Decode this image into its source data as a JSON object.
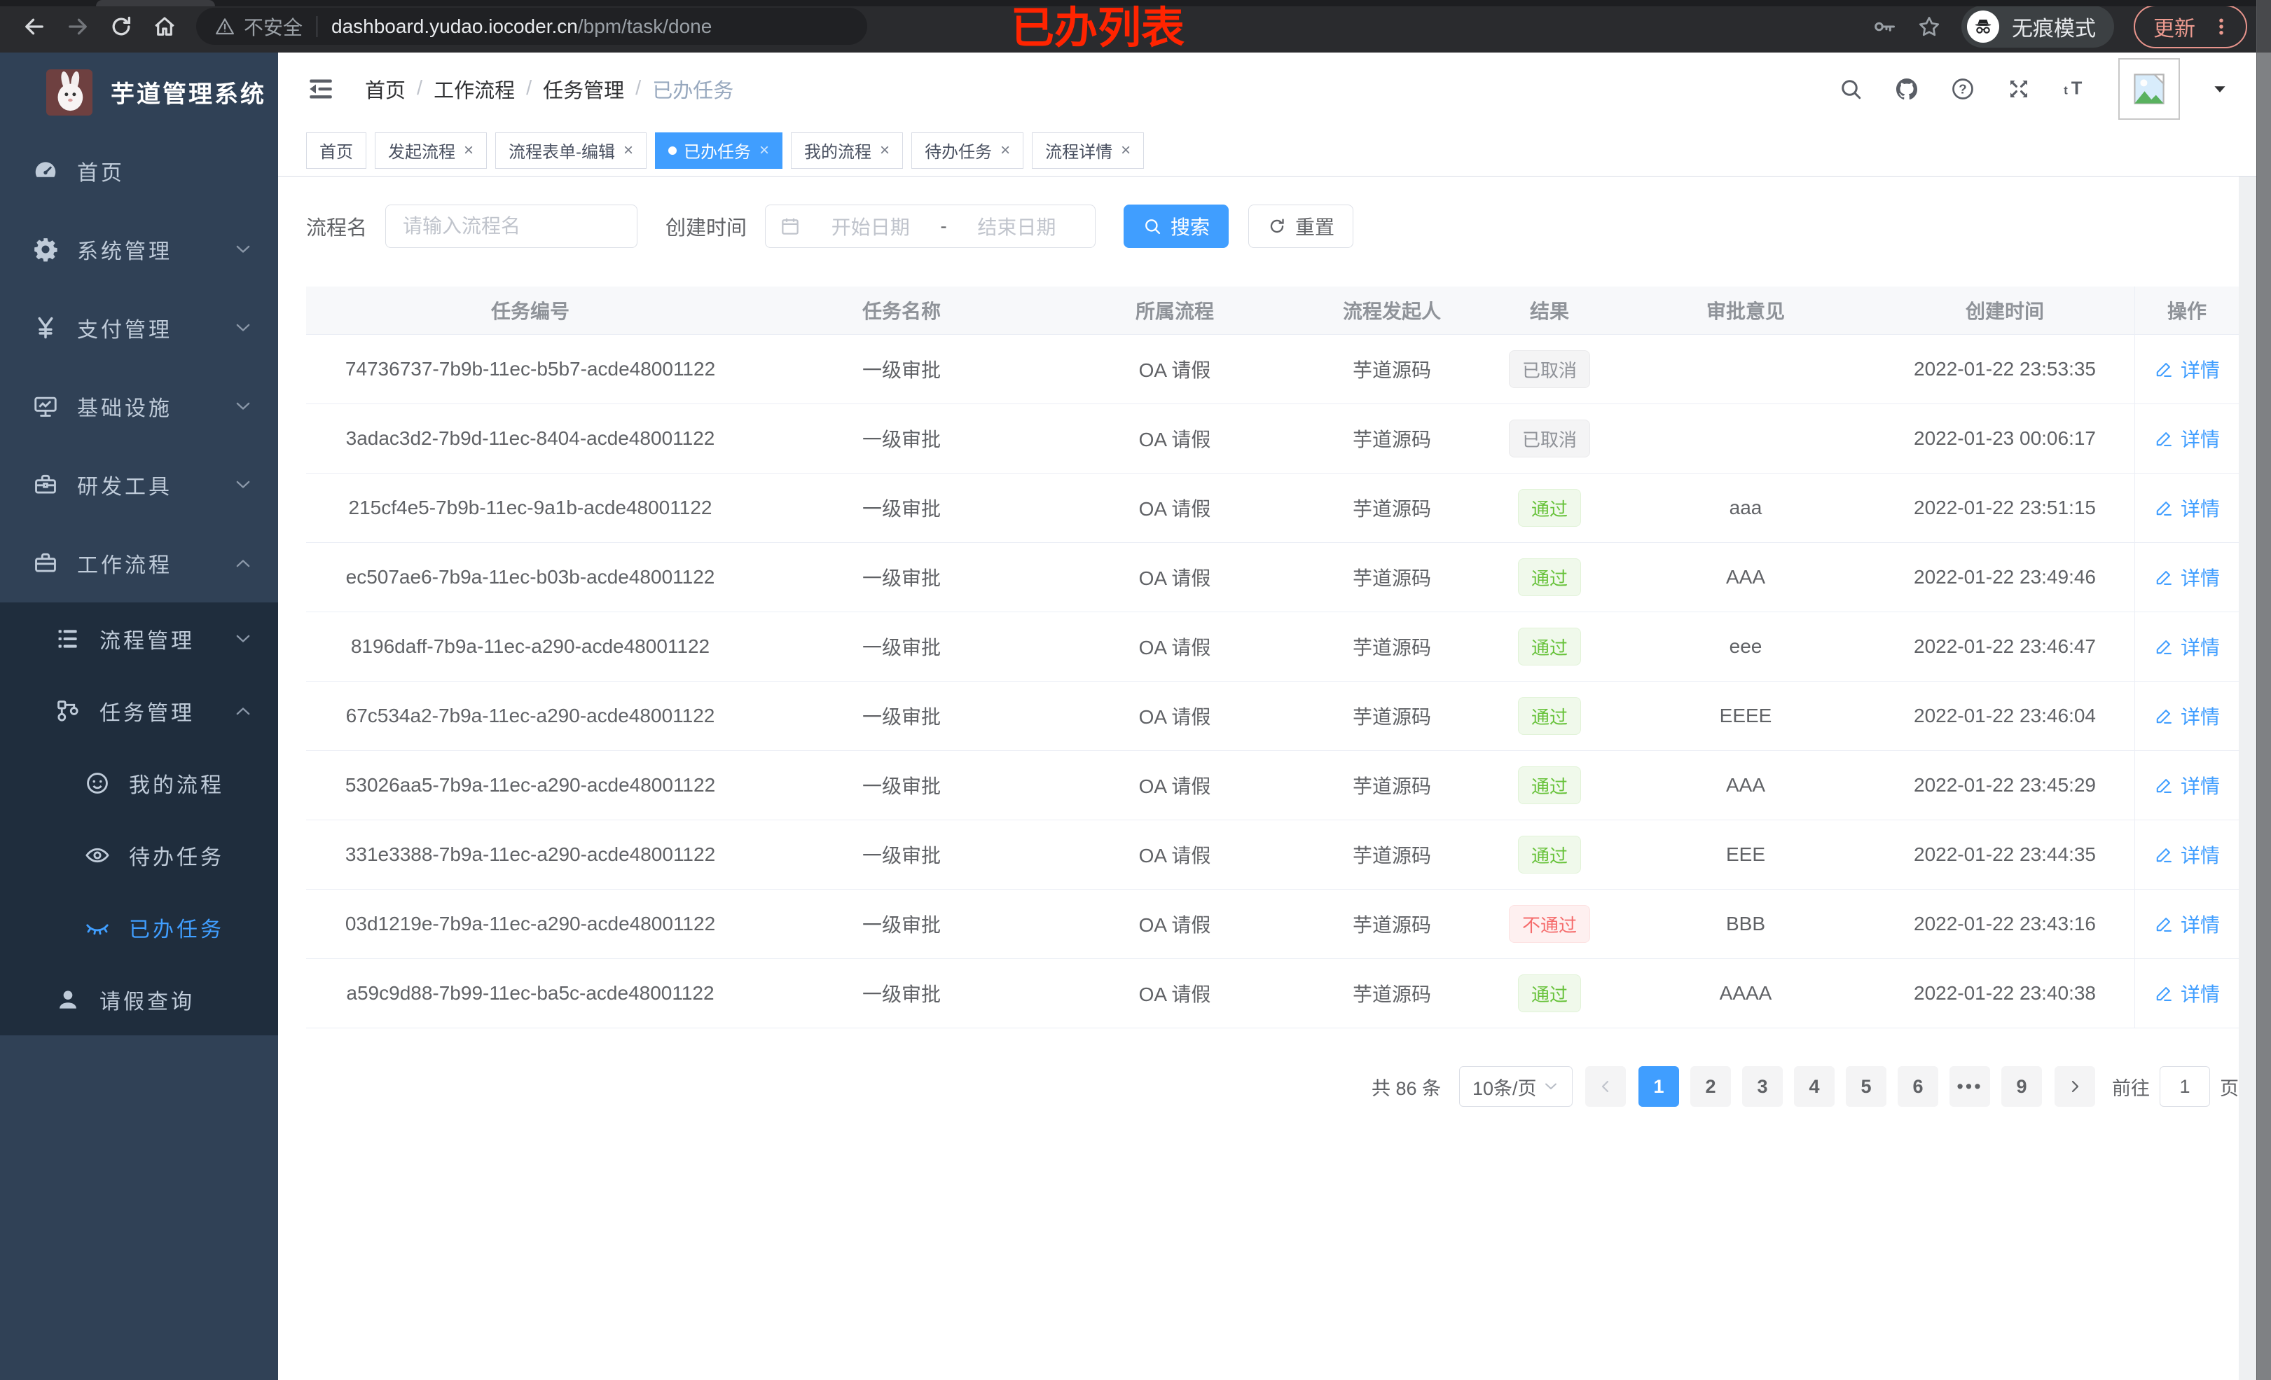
{
  "browser": {
    "annotation": "已办列表",
    "security_label": "不安全",
    "url_host": "dashboard.yudao.iocoder.cn",
    "url_path": "/bpm/task/done",
    "incognito_label": "无痕模式",
    "update_label": "更新"
  },
  "sidebar": {
    "app_title": "芋道管理系统",
    "items": [
      {
        "icon": "dashboard-icon",
        "label": "首页",
        "cls": "lvl1",
        "chev": ""
      },
      {
        "icon": "gear-icon",
        "label": "系统管理",
        "cls": "lvl1",
        "chev": "down"
      },
      {
        "icon": "yen-icon",
        "label": "支付管理",
        "cls": "lvl1",
        "chev": "down"
      },
      {
        "icon": "infra-icon",
        "label": "基础设施",
        "cls": "lvl1",
        "chev": "down"
      },
      {
        "icon": "tools-icon",
        "label": "研发工具",
        "cls": "lvl1",
        "chev": "down"
      },
      {
        "icon": "workflow-icon",
        "label": "工作流程",
        "cls": "lvl1",
        "chev": "up"
      }
    ],
    "workflow_children": [
      {
        "icon": "process-manage-icon",
        "label": "流程管理",
        "cls": "lvl2",
        "chev": "down"
      },
      {
        "icon": "task-manage-icon",
        "label": "任务管理",
        "cls": "lvl2",
        "chev": "up"
      },
      {
        "icon": "my-process-icon",
        "label": "我的流程",
        "cls": "lvl3",
        "chev": ""
      },
      {
        "icon": "todo-task-icon",
        "label": "待办任务",
        "cls": "lvl3",
        "chev": ""
      },
      {
        "icon": "done-task-icon",
        "label": "已办任务",
        "cls": "lvl3 active",
        "chev": ""
      },
      {
        "icon": "leave-query-icon",
        "label": "请假查询",
        "cls": "lvl2",
        "chev": ""
      }
    ]
  },
  "header": {
    "breadcrumb": [
      {
        "label": "首页",
        "cls": "",
        "sep": "/"
      },
      {
        "label": "工作流程",
        "cls": "",
        "sep": "/"
      },
      {
        "label": "任务管理",
        "cls": "",
        "sep": "/"
      },
      {
        "label": "已办任务",
        "cls": "muted",
        "sep": ""
      }
    ]
  },
  "tabs": [
    {
      "label": "首页",
      "cls": "",
      "active": false,
      "closable": false
    },
    {
      "label": "发起流程",
      "cls": "",
      "active": false,
      "closable": true
    },
    {
      "label": "流程表单-编辑",
      "cls": "",
      "active": false,
      "closable": true
    },
    {
      "label": "已办任务",
      "cls": "active",
      "active": true,
      "closable": true
    },
    {
      "label": "我的流程",
      "cls": "",
      "active": false,
      "closable": true
    },
    {
      "label": "待办任务",
      "cls": "",
      "active": false,
      "closable": true
    },
    {
      "label": "流程详情",
      "cls": "",
      "active": false,
      "closable": true
    }
  ],
  "filters": {
    "name_label": "流程名",
    "name_placeholder": "请输入流程名",
    "time_label": "创建时间",
    "start_placeholder": "开始日期",
    "range_separator": "-",
    "end_placeholder": "结束日期",
    "search_label": "搜索",
    "reset_label": "重置"
  },
  "table": {
    "columns": [
      "任务编号",
      "任务名称",
      "所属流程",
      "流程发起人",
      "结果",
      "审批意见",
      "创建时间",
      "操作"
    ],
    "rows": [
      {
        "task_id": "74736737-7b9b-11ec-b5b7-acde48001122",
        "task_name": "一级审批",
        "process": "OA 请假",
        "starter": "芋道源码",
        "result": "已取消",
        "result_state": "tag-info",
        "comment": "",
        "created": "2022-01-22 23:53:35",
        "action": "详情"
      },
      {
        "task_id": "3adac3d2-7b9d-11ec-8404-acde48001122",
        "task_name": "一级审批",
        "process": "OA 请假",
        "starter": "芋道源码",
        "result": "已取消",
        "result_state": "tag-info",
        "comment": "",
        "created": "2022-01-23 00:06:17",
        "action": "详情"
      },
      {
        "task_id": "215cf4e5-7b9b-11ec-9a1b-acde48001122",
        "task_name": "一级审批",
        "process": "OA 请假",
        "starter": "芋道源码",
        "result": "通过",
        "result_state": "tag-success",
        "comment": "aaa",
        "created": "2022-01-22 23:51:15",
        "action": "详情"
      },
      {
        "task_id": "ec507ae6-7b9a-11ec-b03b-acde48001122",
        "task_name": "一级审批",
        "process": "OA 请假",
        "starter": "芋道源码",
        "result": "通过",
        "result_state": "tag-success",
        "comment": "AAA",
        "created": "2022-01-22 23:49:46",
        "action": "详情"
      },
      {
        "task_id": "8196daff-7b9a-11ec-a290-acde48001122",
        "task_name": "一级审批",
        "process": "OA 请假",
        "starter": "芋道源码",
        "result": "通过",
        "result_state": "tag-success",
        "comment": "eee",
        "created": "2022-01-22 23:46:47",
        "action": "详情"
      },
      {
        "task_id": "67c534a2-7b9a-11ec-a290-acde48001122",
        "task_name": "一级审批",
        "process": "OA 请假",
        "starter": "芋道源码",
        "result": "通过",
        "result_state": "tag-success",
        "comment": "EEEE",
        "created": "2022-01-22 23:46:04",
        "action": "详情"
      },
      {
        "task_id": "53026aa5-7b9a-11ec-a290-acde48001122",
        "task_name": "一级审批",
        "process": "OA 请假",
        "starter": "芋道源码",
        "result": "通过",
        "result_state": "tag-success",
        "comment": "AAA",
        "created": "2022-01-22 23:45:29",
        "action": "详情"
      },
      {
        "task_id": "331e3388-7b9a-11ec-a290-acde48001122",
        "task_name": "一级审批",
        "process": "OA 请假",
        "starter": "芋道源码",
        "result": "通过",
        "result_state": "tag-success",
        "comment": "EEE",
        "created": "2022-01-22 23:44:35",
        "action": "详情"
      },
      {
        "task_id": "03d1219e-7b9a-11ec-a290-acde48001122",
        "task_name": "一级审批",
        "process": "OA 请假",
        "starter": "芋道源码",
        "result": "不通过",
        "result_state": "tag-danger",
        "comment": "BBB",
        "created": "2022-01-22 23:43:16",
        "action": "详情"
      },
      {
        "task_id": "a59c9d88-7b99-11ec-ba5c-acde48001122",
        "task_name": "一级审批",
        "process": "OA 请假",
        "starter": "芋道源码",
        "result": "通过",
        "result_state": "tag-success",
        "comment": "AAAA",
        "created": "2022-01-22 23:40:38",
        "action": "详情"
      }
    ]
  },
  "pagination": {
    "total_label": "共 86 条",
    "page_size": "10条/页",
    "pages": [
      {
        "label": "1",
        "cls": "active"
      },
      {
        "label": "2",
        "cls": ""
      },
      {
        "label": "3",
        "cls": ""
      },
      {
        "label": "4",
        "cls": ""
      },
      {
        "label": "5",
        "cls": ""
      },
      {
        "label": "6",
        "cls": ""
      },
      {
        "label": "•••",
        "cls": "more"
      },
      {
        "label": "9",
        "cls": ""
      }
    ],
    "goto_label": "前往",
    "goto_value": "1",
    "page_unit": "页"
  }
}
